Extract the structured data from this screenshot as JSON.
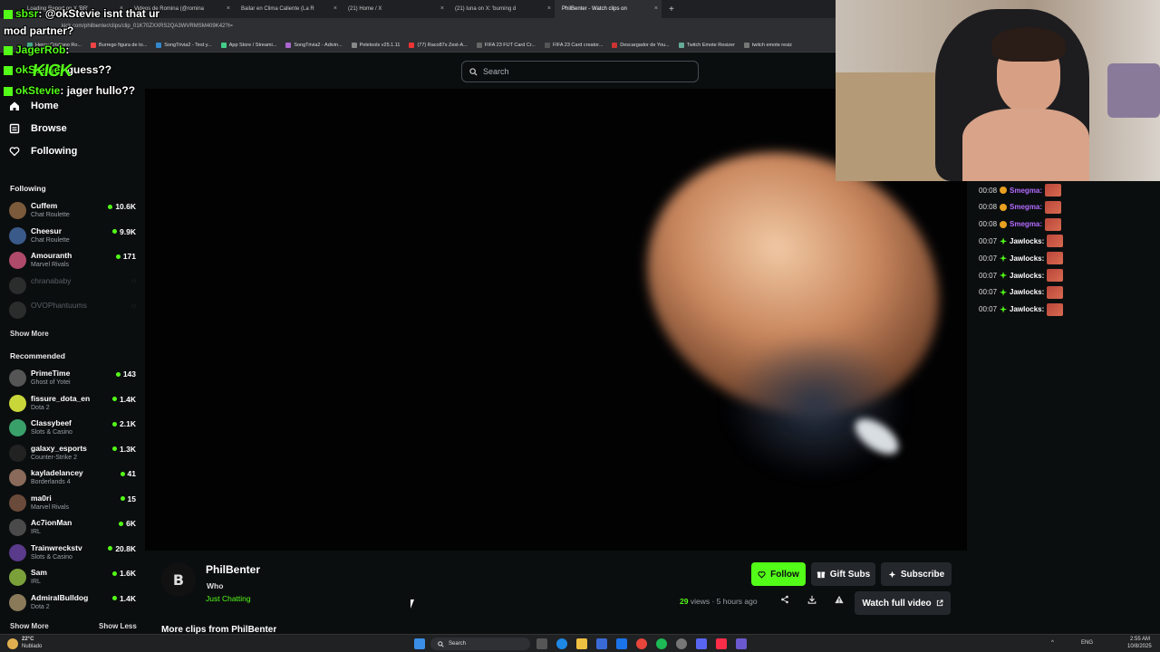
{
  "browser": {
    "tabs": [
      {
        "label": "Loading Report on X 'BR'"
      },
      {
        "label": "Videos de Romina (@romina"
      },
      {
        "label": "Bailar en Clima Caliente (La R"
      },
      {
        "label": "(21) Home / X"
      },
      {
        "label": "(21) luna on X: 'burning d"
      },
      {
        "label": "PhilBenter - Watch clips on"
      }
    ],
    "url": "kick.com/philbenter/clips/clip_01K70ZXXRS2QA3WVRMSM409K42?t=",
    "bookmarks": [
      "Henry Cristiano Ro...",
      "Burrego figura de to...",
      "SongTrivia2 - Test y...",
      "App Store / Streami...",
      "SongTrivia2 - Adivin...",
      "Peletools v25.1.11",
      "(77) Raco87s Zest-A...",
      "FIFA 23 FUT Card Cr...",
      "FIFA 23 Card creator...",
      "Descargador de You...",
      "Twitch Emote Resizer",
      "twitch emote resiz"
    ]
  },
  "search": {
    "placeholder": "Search"
  },
  "nav": {
    "home": "Home",
    "browse": "Browse",
    "following": "Following"
  },
  "sidebar": {
    "following_title": "Following",
    "following": [
      {
        "name": "Cuffem",
        "category": "Chat Roulette",
        "viewers": "10.6K",
        "color": "#7a5a3a"
      },
      {
        "name": "Cheesur",
        "category": "Chat Roulette",
        "viewers": "9.9K",
        "color": "#3a5a8a"
      },
      {
        "name": "Amouranth",
        "category": "Marvel Rivals",
        "viewers": "171",
        "color": "#b04a6a"
      },
      {
        "name": "chranababy",
        "category": "",
        "viewers": "",
        "color": "#666"
      },
      {
        "name": "OVOPhantuums",
        "category": "",
        "viewers": "",
        "color": "#666"
      }
    ],
    "show_more": "Show More",
    "recommended_title": "Recommended",
    "recommended": [
      {
        "name": "PrimeTime",
        "category": "Ghost of Yotei",
        "viewers": "143",
        "color": "#555"
      },
      {
        "name": "fissure_dota_en",
        "category": "Dota 2",
        "viewers": "1.4K",
        "color": "#c9d63a"
      },
      {
        "name": "Classybeef",
        "category": "Slots & Casino",
        "viewers": "2.1K",
        "color": "#3aa06a"
      },
      {
        "name": "galaxy_esports",
        "category": "Counter-Strike 2",
        "viewers": "1.3K",
        "color": "#222"
      },
      {
        "name": "kayladelancey",
        "category": "Borderlands 4",
        "viewers": "41",
        "color": "#8a6a5a"
      },
      {
        "name": "ma0ri",
        "category": "Marvel Rivals",
        "viewers": "15",
        "color": "#6a4a3a"
      },
      {
        "name": "Ac7ionMan",
        "category": "IRL",
        "viewers": "6K",
        "color": "#4a4a4a"
      },
      {
        "name": "Trainwreckstv",
        "category": "Slots & Casino",
        "viewers": "20.8K",
        "color": "#5a3a8a"
      },
      {
        "name": "Sam",
        "category": "IRL",
        "viewers": "1.6K",
        "color": "#7aa03a"
      },
      {
        "name": "AdmiralBulldog",
        "category": "Dota 2",
        "viewers": "1.4K",
        "color": "#8a7a5a"
      }
    ],
    "show_more_bottom": "Show More",
    "show_less": "Show Less"
  },
  "clip": {
    "logo_letter": "B",
    "channel": "PhilBenter",
    "title": "Who",
    "category": "Just Chatting",
    "views": "29",
    "views_label": "views",
    "age": "5 hours ago",
    "follow": "Follow",
    "gift_subs": "Gift Subs",
    "subscribe": "Subscribe",
    "watch_full": "Watch full video",
    "more_clips": "More clips from PhilBenter"
  },
  "chat": [
    {
      "time": "00:08",
      "user": "Smegma:",
      "color": "#b36bff"
    },
    {
      "time": "00:08",
      "user": "Smegma:",
      "color": "#b36bff"
    },
    {
      "time": "00:08",
      "user": "Smegma:",
      "color": "#b36bff"
    },
    {
      "time": "00:07",
      "user": "Jawlocks:",
      "color": "#ffffff"
    },
    {
      "time": "00:07",
      "user": "Jawlocks:",
      "color": "#ffffff"
    },
    {
      "time": "00:07",
      "user": "Jawlocks:",
      "color": "#ffffff"
    },
    {
      "time": "00:07",
      "user": "Jawlocks:",
      "color": "#ffffff"
    },
    {
      "time": "00:07",
      "user": "Jawlocks:",
      "color": "#ffffff"
    }
  ],
  "overlay_chat": [
    {
      "user": "sbsr",
      "text": ": @okStevie isnt that ur mod partner?"
    },
    {
      "user": "JagerRob",
      "text": ":"
    },
    {
      "user": "okStevie",
      "text": ": guess??"
    },
    {
      "user": "okStevie",
      "text": ": jager hullo??"
    }
  ],
  "overlay_brand": "KICK",
  "taskbar": {
    "weather_temp": "22°C",
    "weather_text": "Nublado",
    "search": "Search",
    "lang": "ENG",
    "time": "2:55 AM",
    "date": "10/8/2025"
  },
  "colors": {
    "accent": "#53fc18",
    "background": "#0b0e0f"
  }
}
